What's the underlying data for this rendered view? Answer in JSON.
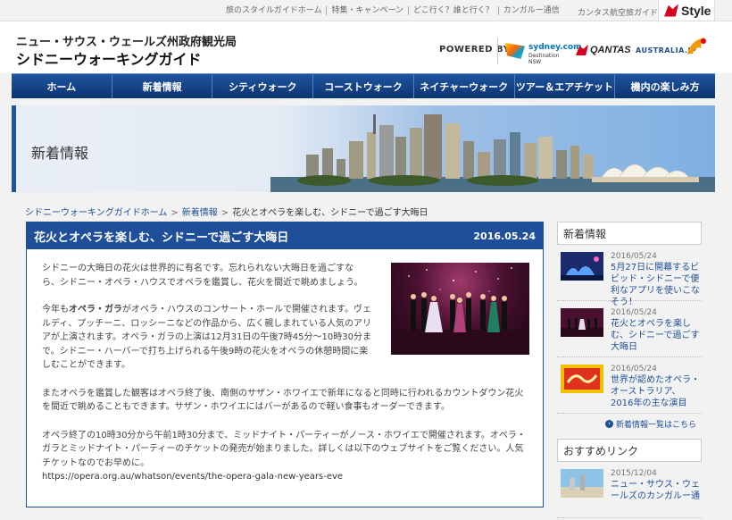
{
  "topbar": {
    "links": [
      "旅のスタイルガイドホーム",
      "特集・キャンペーン",
      "どこ行く？誰と行く？",
      "カンガルー通信"
    ],
    "guide": "カンタス航空旅ガイド",
    "style_logo": "Style"
  },
  "header": {
    "subtitle": "ニュー・サウス・ウェールズ州政府観光局",
    "title": "シドニーウォーキングガイド",
    "powered_by": "POWERED BY",
    "sponsor_sydney": "sydney.com",
    "sponsor_sydney_sub": "Destination NSW",
    "sponsor_qantas": "QANTAS",
    "sponsor_australia": "AUSTRALIA.JP"
  },
  "nav": {
    "items": [
      "ホーム",
      "新着情報",
      "シティウォーク",
      "コーストウォーク",
      "ネイチャーウォーク",
      "ツアー＆エアチケット",
      "機内の楽しみ方"
    ]
  },
  "hero": {
    "title": "新着情報"
  },
  "breadcrumb": {
    "home": "シドニーウォーキングガイドホーム",
    "section": "新着情報",
    "sep": ">",
    "current": "花火とオペラを楽しむ、シドニーで過ごす大晦日"
  },
  "article": {
    "title": "花火とオペラを楽しむ、シドニーで過ごす大晦日",
    "date": "2016.05.24",
    "p1": "シドニーの大晦日の花火は世界的に有名です。忘れられない大晦日を過ごすなら、シドニー・オペラ・ハウスでオペラを鑑賞し、花火を間近で眺めましょう。",
    "p2_pre": "今年も",
    "p2_bold": "オペラ・ガラ",
    "p2_post": "がオペラ・ハウスのコンサート・ホールで開催されます。ヴェルディ、プッチーニ、ロッシーニなどの作品から、広く親しまれている人気のアリアが上演されます。オペラ・ガラの上演は12月31日の午後7時45分～10時30分まで。シドニー・ハーバーで打ち上げられる午後9時の花火をオペラの休憩時間に楽しむことができます。",
    "p3": "またオペラを鑑賞した観客はオペラ終了後、南側のサザン・ホワイエで新年になると同時に行われるカウントダウン花火を間近で眺めることもできます。サザン・ホワイエにはバーがあるので軽い食事もオーダーできます。",
    "p4": "オペラ終了の10時30分から午前1時30分まで、ミッドナイト・パーティーがノース・ホワイエで開催されます。オペラ・ガラとミッドナイト・パーティーのチケットの発売が始まりました。詳しくは以下のウェブサイトをご覧ください。人気チケットなのでお早めに。",
    "url": "https://opera.org.au/whatson/events/the-opera-gala-new-years-eve"
  },
  "sidebar": {
    "news_heading": "新着情報",
    "items": [
      {
        "date": "2016/05/24",
        "text": "5月27日に開幕するビビッド・シドニーで便利なアプリを使いこなそう！"
      },
      {
        "date": "2016/05/24",
        "text": "花火とオペラを楽しむ、シドニーで過ごす大晦日"
      },
      {
        "date": "2016/05/24",
        "text": "世界が認めたオペラ・オーストラリア、2016年の主な演目"
      }
    ],
    "more": "新着情報一覧はこちら",
    "recommend_heading": "おすすめリンク",
    "recommend_item": {
      "date": "2015/12/04",
      "text": "ニュー・サウス・ウェールズのカンガルー通"
    }
  },
  "colors": {
    "navy": "#1f4f9a",
    "nav_bg": "#0e3e7e"
  }
}
